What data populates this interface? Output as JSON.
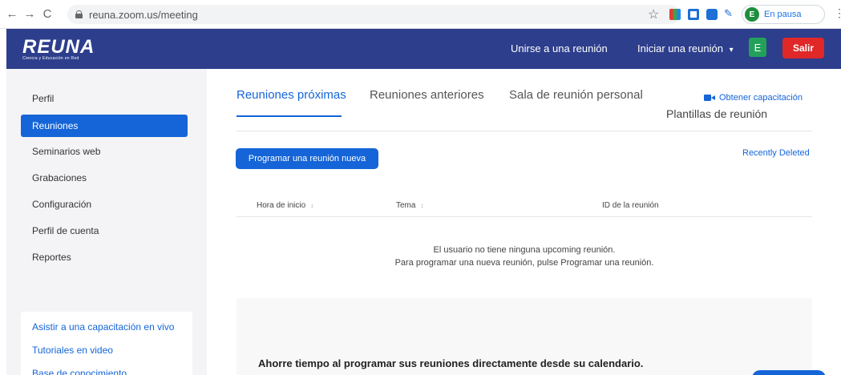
{
  "browser": {
    "back": "←",
    "forward": "→",
    "reload": "C",
    "url": "reuna.zoom.us/meeting",
    "profile_initial": "E",
    "profile_status": "En pausa"
  },
  "header": {
    "logo": "REUNA",
    "logo_subtitle": "Ciencia y Educación en Red",
    "join": "Unirse a una reunión",
    "host": "Iniciar una reunión",
    "host_caret": "▾",
    "user_initial": "E",
    "signout": "Salir"
  },
  "sidebar": {
    "items": [
      {
        "label": "Perfil"
      },
      {
        "label": "Reuniones"
      },
      {
        "label": "Seminarios web"
      },
      {
        "label": "Grabaciones"
      },
      {
        "label": "Configuración"
      },
      {
        "label": "Perfil de cuenta"
      },
      {
        "label": "Reportes"
      }
    ],
    "links": [
      {
        "label": "Asistir a una capacitación en vivo"
      },
      {
        "label": "Tutoriales en video"
      },
      {
        "label": "Base de conocimiento"
      }
    ]
  },
  "main": {
    "tabs": [
      {
        "label": "Reuniones próximas"
      },
      {
        "label": "Reuniones anteriores"
      },
      {
        "label": "Sala de reunión personal"
      }
    ],
    "training_link": "Obtener capacitación",
    "templates": "Plantillas de reunión",
    "schedule_button": "Programar una reunión nueva",
    "recently_deleted": "Recently Deleted",
    "columns": [
      {
        "label": "Hora de inicio",
        "sort": "↕"
      },
      {
        "label": "Tema",
        "sort": "↕"
      },
      {
        "label": "ID de la reunión"
      }
    ],
    "empty_line1": "El usuario no tiene ninguna upcoming reunión.",
    "empty_line2": "Para programar una nueva reunión, pulse Programar una reunión.",
    "calendar_promo": "Ahorre tiempo al programar sus reuniones directamente desde su calendario."
  }
}
